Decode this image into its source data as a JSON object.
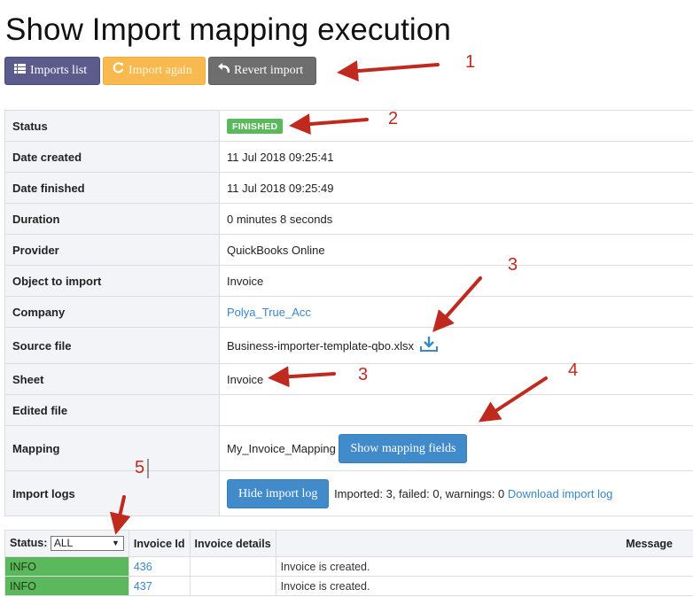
{
  "page": {
    "title": "Show Import mapping execution"
  },
  "toolbar": {
    "imports_list": {
      "label": "Imports list",
      "icon": "list-icon"
    },
    "import_again": {
      "label": "Import again",
      "icon": "refresh-icon"
    },
    "revert_import": {
      "label": "Revert import",
      "icon": "undo-icon"
    }
  },
  "details": {
    "status": {
      "label": "Status",
      "value": "FINISHED",
      "color": "#5cb85c"
    },
    "date_created": {
      "label": "Date created",
      "value": "11 Jul 2018 09:25:41"
    },
    "date_finished": {
      "label": "Date finished",
      "value": "11 Jul 2018 09:25:49"
    },
    "duration": {
      "label": "Duration",
      "value": "0 minutes 8 seconds"
    },
    "provider": {
      "label": "Provider",
      "value": "QuickBooks Online"
    },
    "object_to_import": {
      "label": "Object to import",
      "value": "Invoice"
    },
    "company": {
      "label": "Company",
      "value": "Polya_True_Acc"
    },
    "source_file": {
      "label": "Source file",
      "value": "Business-importer-template-qbo.xlsx",
      "icon": "download-icon"
    },
    "sheet": {
      "label": "Sheet",
      "value": "Invoice"
    },
    "edited_file": {
      "label": "Edited file",
      "value": ""
    },
    "mapping": {
      "label": "Mapping",
      "value": "My_Invoice_Mapping",
      "button": "Show mapping fields"
    },
    "import_logs": {
      "label": "Import logs",
      "button": "Hide import log",
      "summary": "Imported: 3, failed: 0, warnings: 0",
      "download_link": "Download import log"
    }
  },
  "logs": {
    "columns": {
      "status": "Status:",
      "invoice_id": "Invoice Id",
      "invoice_details": "Invoice details",
      "message": "Message"
    },
    "status_filter": "ALL",
    "rows": [
      {
        "status": "INFO",
        "invoice_id": "436",
        "details": "",
        "message": "Invoice is created."
      },
      {
        "status": "INFO",
        "invoice_id": "437",
        "details": "",
        "message": "Invoice is created."
      }
    ]
  },
  "annotations": {
    "color": "#c0291e",
    "labels": [
      "1",
      "2",
      "3",
      "3",
      "4",
      "5"
    ]
  }
}
